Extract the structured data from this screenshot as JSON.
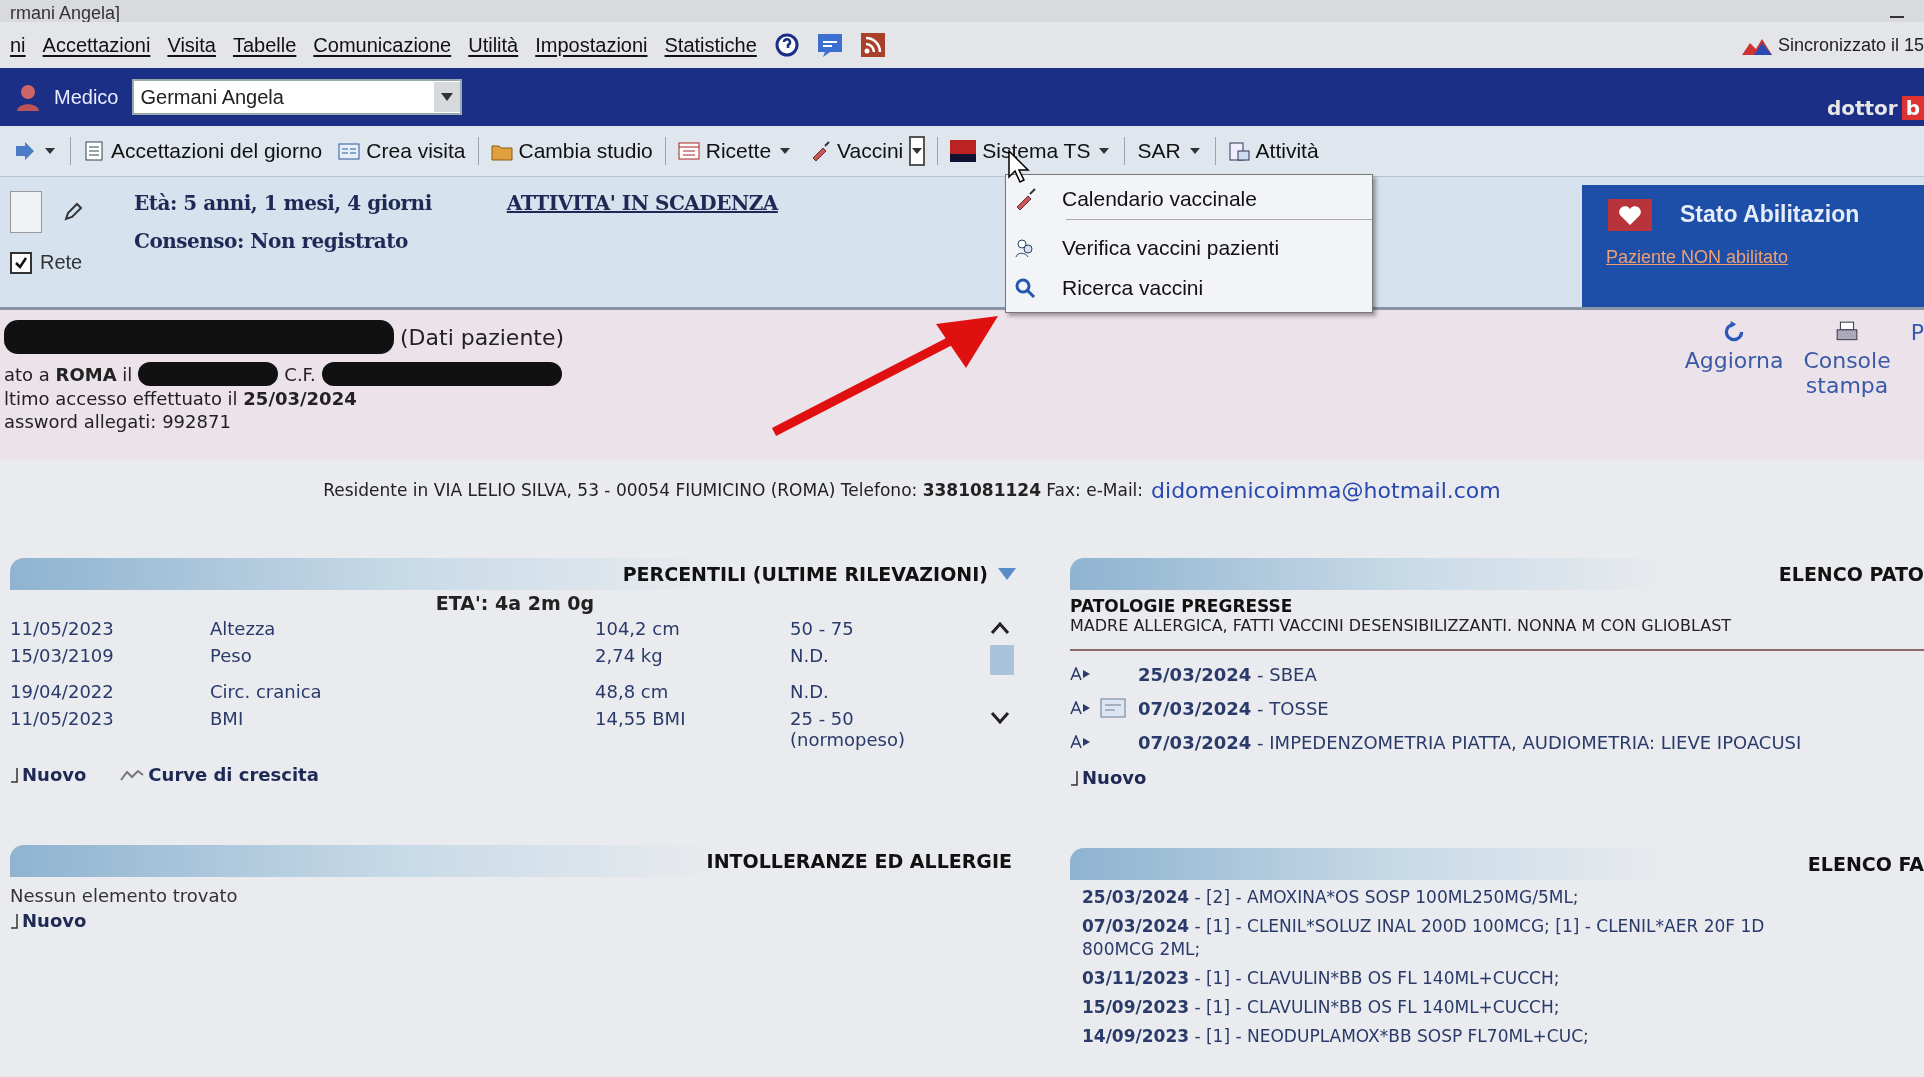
{
  "window": {
    "title": "rmani Angela]"
  },
  "menu": [
    "ni",
    "Accettazioni",
    "Visita",
    "Tabelle",
    "Comunicazione",
    "Utilità",
    "Impostazioni",
    "Statistiche"
  ],
  "sync_status": "Sincronizzato il 15",
  "doctor_bar": {
    "label": "Medico",
    "doctor": "Germani Angela",
    "brand": "dottor",
    "brand_tail": "b"
  },
  "toolbar": [
    {
      "kind": "nav",
      "dropdown": true,
      "open": false
    },
    {
      "kind": "list",
      "label": "Accettazioni del giorno",
      "dropdown": false
    },
    {
      "kind": "form",
      "label": "Crea visita",
      "dropdown": false
    },
    {
      "kind": "folder",
      "label": "Cambia studio",
      "dropdown": false
    },
    {
      "kind": "table",
      "label": "Ricette",
      "dropdown": true,
      "open": false
    },
    {
      "kind": "syringe",
      "label": "Vaccini",
      "dropdown": true,
      "open": true
    },
    {
      "kind": "ts",
      "label": "Sistema TS",
      "dropdown": true,
      "open": false
    },
    {
      "kind": "plain",
      "label": "SAR",
      "dropdown": true,
      "open": false
    },
    {
      "kind": "tasks",
      "label": "Attività",
      "dropdown": false
    }
  ],
  "dropdown_menu": [
    {
      "kind": "syringe",
      "label": "Calendario vaccinale",
      "separator_after": true
    },
    {
      "kind": "people",
      "label": "Verifica vaccini pazienti",
      "separator_after": false
    },
    {
      "kind": "search",
      "label": "Ricerca vaccini",
      "separator_after": false
    }
  ],
  "patient_header": {
    "age": "Età:  5 anni, 1 mesi, 4 giorni",
    "consent": "Consenso: Non registrato",
    "network": {
      "label": "Rete",
      "checked": true
    },
    "link": "ATTIVITA' IN SCADENZA"
  },
  "enablement": {
    "title": "Stato Abilitazion",
    "link": "Paziente NON abilitato"
  },
  "patient": {
    "name_suffix": "(Dati paziente)",
    "birth": "ato a **ROMA** il",
    "cf": "C.F.",
    "last_access": "ltimo accesso effettuato il **25/03/2024**",
    "password": "assword allegati: 992871",
    "actions": [
      {
        "kind": "refresh",
        "label": "Aggiorna"
      },
      {
        "kind": "printer",
        "label": "Console\nstampa"
      },
      {
        "kind": "plain",
        "label": "P"
      }
    ]
  },
  "residence": {
    "text": "Residente in VIA LELIO SILVA, 53 - 00054 FIUMICINO (ROMA) Telefono: **3381081124** Fax: e-Mail:",
    "email": "didomenicoimma@hotmail.com"
  },
  "percentiles": {
    "title": "PERCENTILI (ULTIME RILEVAZIONI)",
    "age": "ETA': 4a 2m 0g",
    "rows": [
      {
        "date": "11/05/2023",
        "measure": "Altezza",
        "value": "104,2 cm",
        "percentile": "50 - 75"
      },
      {
        "date": "15/03/2109",
        "measure": "Peso",
        "value": "2,74 kg",
        "percentile": "N.D."
      },
      {
        "date": "19/04/2022",
        "measure": "Circ. cranica",
        "value": "48,8 cm",
        "percentile": "N.D."
      },
      {
        "date": "11/05/2023",
        "measure": "BMI",
        "value": "14,55 BMI",
        "percentile": "25 - 50",
        "note": "(normopeso)"
      }
    ],
    "actions": [
      {
        "kind": "new",
        "label": "Nuovo"
      },
      {
        "kind": "chart",
        "label": "Curve di crescita"
      }
    ]
  },
  "allergies": {
    "title": "INTOLLERANZE ED ALLERGIE",
    "empty": "Nessun elemento trovato",
    "actions": [
      {
        "kind": "new",
        "label": "Nuovo"
      }
    ]
  },
  "pathologies": {
    "title": "ELENCO PATO",
    "section": "PATOLOGIE PREGRESSE",
    "notes": "MADRE ALLERGICA, FATTI VACCINI DESENSIBILIZZANTI. NONNA M CON GLIOBLAST",
    "entries": [
      {
        "date": "25/03/2024",
        "text": "- SBEA",
        "attachment": false
      },
      {
        "date": "07/03/2024",
        "text": "- TOSSE",
        "attachment": true
      },
      {
        "date": "07/03/2024",
        "text": "- IMPEDENZOMETRIA PIATTA, AUDIOMETRIA: LIEVE IPOACUSI",
        "attachment": false
      }
    ],
    "action": "Nuovo"
  },
  "drugs": {
    "title": "ELENCO FA",
    "entries": [
      {
        "date": "25/03/2024",
        "text": "- [2] - AMOXINA*OS SOSP 100ML250MG/5ML;"
      },
      {
        "date": "07/03/2024",
        "text": "- [1] - CLENIL*SOLUZ INAL 200D 100MCG; [1] - CLENIL*AER 20F 1D",
        "cont": "800MCG 2ML;"
      },
      {
        "date": "03/11/2023",
        "text": "- [1] - CLAVULIN*BB OS FL 140ML+CUCCH;"
      },
      {
        "date": "15/09/2023",
        "text": "- [1] - CLAVULIN*BB OS FL 140ML+CUCCH;"
      },
      {
        "date": "14/09/2023",
        "text": "- [1] - NEODUPLAMOX*BB SOSP FL70ML+CUC;"
      }
    ]
  }
}
